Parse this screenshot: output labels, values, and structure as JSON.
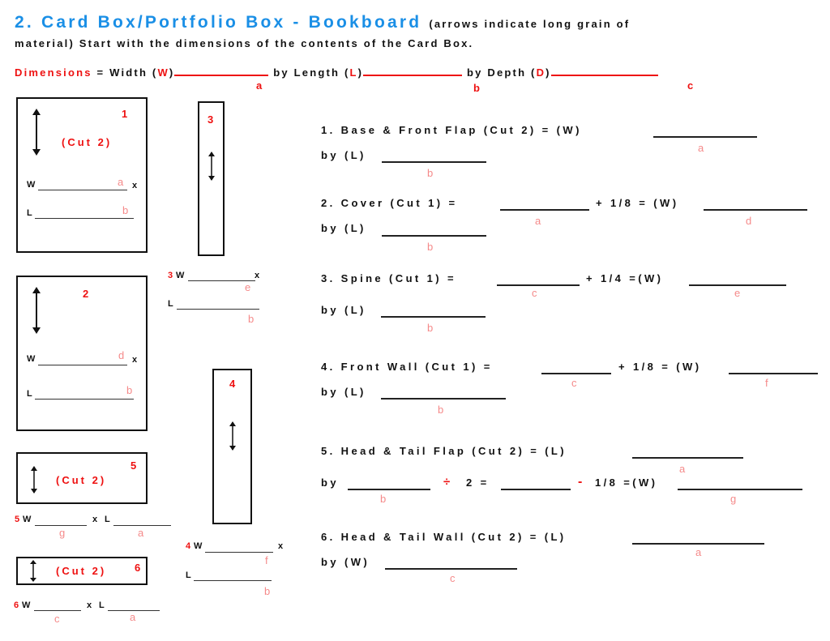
{
  "header": {
    "title": "2. Card Box/Portfolio Box - Bookboard",
    "title_note": "(arrows indicate long grain of",
    "subtitle": "material) Start with the dimensions of the contents of the Card Box.",
    "colors": {
      "title": "#1a8fe6",
      "accent": "#ee1111",
      "hint": "#f58a8a"
    }
  },
  "dimensions": {
    "label": "Dimensions",
    "eq": " = Width (",
    "w": "W",
    "close": ")",
    "by_length": " by Length (",
    "l": "L",
    "by_depth": " by Depth (",
    "d": "D",
    "hints": [
      "a",
      "b",
      "c"
    ]
  },
  "pieces": {
    "p1": {
      "num": "1",
      "cut": "(Cut 2)",
      "w": "W",
      "x": "x",
      "l": "L",
      "w_hint": "a",
      "l_hint": "b"
    },
    "p2": {
      "num": "2",
      "w": "W",
      "x": "x",
      "l": "L",
      "w_hint": "d",
      "l_hint": "b"
    },
    "p3": {
      "num": "3",
      "w": "W",
      "x": "x",
      "l": "L",
      "w_hint": "e",
      "l_hint": "b"
    },
    "p4": {
      "num": "4",
      "w": "W",
      "x": "x",
      "l": "L",
      "w_hint": "f",
      "l_hint": "b"
    },
    "p5": {
      "num": "5",
      "cut": "(Cut 2)",
      "w": "W",
      "x": "x",
      "l": "L",
      "w_hint": "g",
      "l_hint": "a"
    },
    "p6": {
      "num": "6",
      "cut": "(Cut 2)",
      "w": "W",
      "x": "x",
      "l": "L",
      "w_hint": "c",
      "l_hint": "a"
    }
  },
  "steps": [
    {
      "line1": "1. Base & Front Flap (Cut 2) = (W)",
      "h1": "a",
      "line2": "by (L)",
      "h2": "b"
    },
    {
      "line1a": "2. Cover (Cut 1) =",
      "h1a": "a",
      "line1b": "+ 1/8 = (W)",
      "h1b": "d",
      "line2": "by (L)",
      "h2": "b"
    },
    {
      "line1a": "3. Spine (Cut 1) =",
      "h1a": "c",
      "line1b": "+ 1/4 =(W)",
      "h1b": "e",
      "line2": "by (L)",
      "h2": "b"
    },
    {
      "line1a": "4. Front Wall (Cut 1) =",
      "h1a": "c",
      "line1b": "+ 1/8 = (W)",
      "h1b": "f",
      "line2": "by (L)",
      "h2": "b"
    },
    {
      "line1": "5. Head & Tail Flap (Cut 2) = (L)",
      "h1": "a",
      "by": "by",
      "h2": "b",
      "div": "÷",
      "two": "2 =",
      "minus": "-",
      "eighth": "1/8 =(W)",
      "h3": "g"
    },
    {
      "line1": "6. Head & Tail Wall (Cut 2) = (L)",
      "h1": "a",
      "line2": "by (W)",
      "h2": "c"
    }
  ]
}
